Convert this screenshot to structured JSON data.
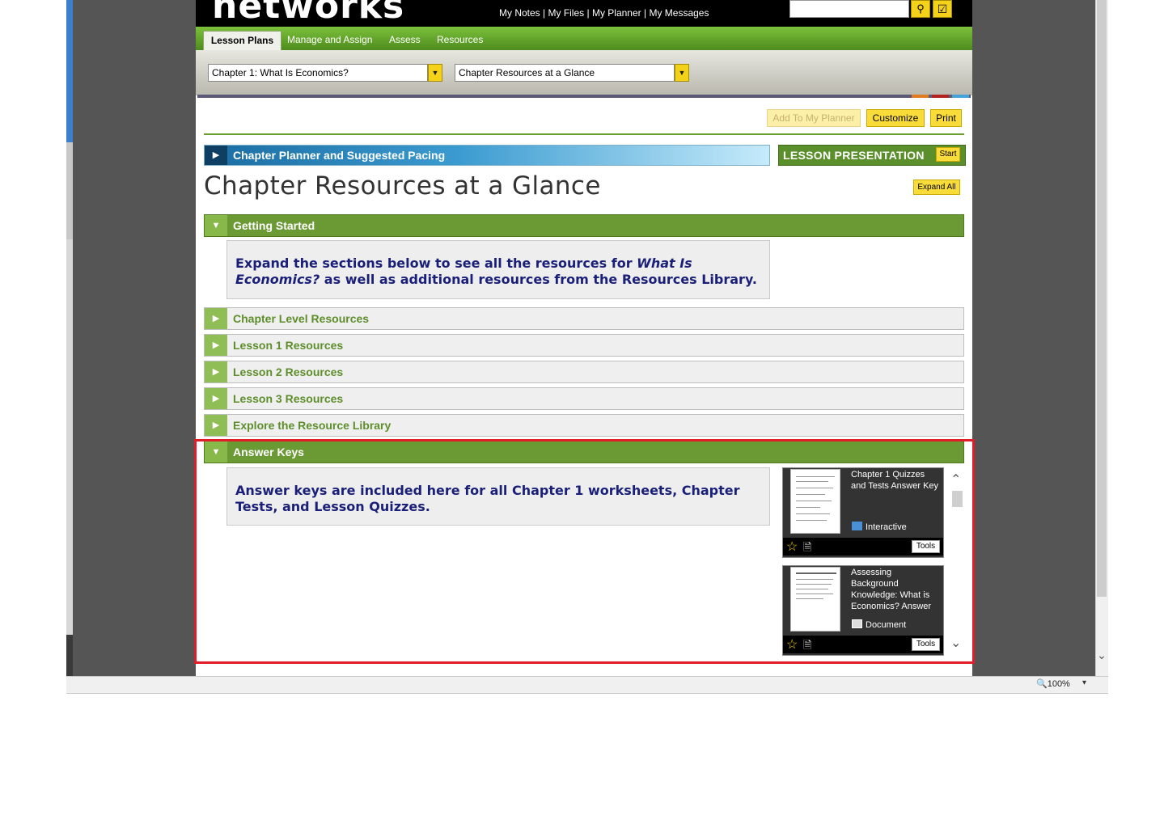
{
  "header": {
    "logo": "networks",
    "links": [
      "My Notes",
      "My Files",
      "My Planner",
      "My Messages"
    ],
    "link_separator": " | ",
    "search_icon": "search-icon",
    "check_icon": "checkmark-icon"
  },
  "nav": {
    "tabs": [
      "Lesson Plans",
      "Manage and Assign",
      "Assess",
      "Resources"
    ],
    "active": "Lesson Plans"
  },
  "selectors": {
    "chapter": "Chapter 1: What Is Economics?",
    "view": "Chapter Resources at a Glance"
  },
  "toolbar": {
    "add_to_planner": "Add To My Planner",
    "customize": "Customize",
    "print": "Print"
  },
  "planner_bar": {
    "label": "Chapter Planner and Suggested Pacing"
  },
  "lesson_presentation": {
    "label": "LESSON PRESENTATION",
    "start": "Start"
  },
  "page": {
    "title": "Chapter Resources at a Glance",
    "expand_all": "Expand All"
  },
  "sections": [
    {
      "label": "Getting Started",
      "open": true
    },
    {
      "label": "Chapter Level Resources",
      "open": false
    },
    {
      "label": "Lesson 1 Resources",
      "open": false
    },
    {
      "label": "Lesson 2 Resources",
      "open": false
    },
    {
      "label": "Lesson 3 Resources",
      "open": false
    },
    {
      "label": "Explore the Resource Library",
      "open": false
    },
    {
      "label": "Answer Keys",
      "open": true
    }
  ],
  "getting_started_note": {
    "before": "Expand the sections below to see all the resources for ",
    "italic": "What Is Economics?",
    "after": " as well as additional resources from the Resources Library."
  },
  "answer_keys_note": "Answer keys are included here for all Chapter 1 worksheets, Chapter Tests, and Lesson Quizzes.",
  "cards": [
    {
      "title": "Chapter 1 Quizzes and Tests Answer Key",
      "type": "Interactive",
      "tools": "Tools"
    },
    {
      "title": "Assessing Background Knowledge: What is Economics? Answer",
      "type": "Document",
      "tools": "Tools"
    }
  ],
  "status_bar": {
    "zoom": "100%"
  },
  "colors": {
    "nav_green": "#5e9a28",
    "section_green": "#6b9a35",
    "button_yellow": "#f9dc3a",
    "note_text": "#1a1f78",
    "highlight_red": "#e11d2a"
  }
}
